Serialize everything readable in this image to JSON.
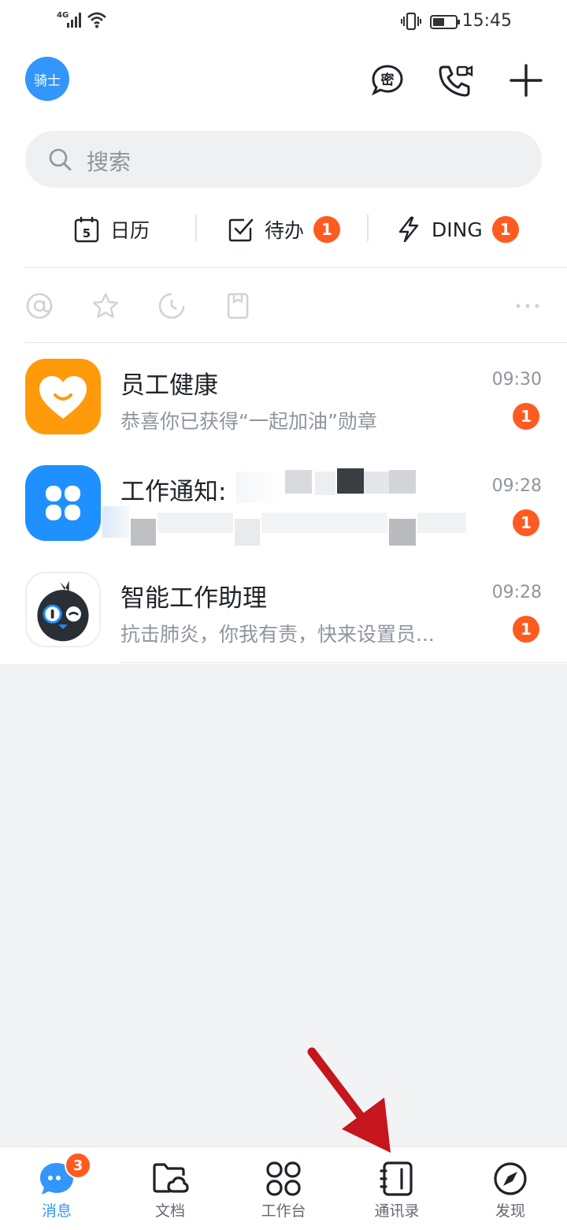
{
  "status_bar": {
    "network": "4G",
    "time": "15:45"
  },
  "header": {
    "avatar_text": "骑士",
    "icons": [
      "secret-chat-icon",
      "video-call-icon",
      "plus-icon"
    ]
  },
  "search": {
    "placeholder": "搜索"
  },
  "quick_bar": {
    "calendar": {
      "label": "日历",
      "day": "5"
    },
    "todo": {
      "label": "待办",
      "badge": "1"
    },
    "ding": {
      "label": "DING",
      "badge": "1"
    }
  },
  "filters": [
    "at-icon",
    "star-icon",
    "clock-icon",
    "bookmark-icon",
    "more-icon"
  ],
  "conversations": [
    {
      "title": "员工健康",
      "preview": "恭喜你已获得“一起加油”勋章",
      "time": "09:30",
      "badge": "1",
      "icon": "heart-app-icon",
      "color": "#ff9a0a"
    },
    {
      "title": "工作通知:",
      "preview": "",
      "time": "09:28",
      "badge": "1",
      "icon": "clover-app-icon",
      "color": "#1e90ff"
    },
    {
      "title": "智能工作助理",
      "preview": "抗击肺炎，你我有责，快来设置员...",
      "time": "09:28",
      "badge": "1",
      "icon": "robot-bird-icon",
      "color": "#ffffff"
    }
  ],
  "bottom_nav": {
    "items": [
      {
        "label": "消息",
        "badge": "3",
        "active": true
      },
      {
        "label": "文档"
      },
      {
        "label": "工作台"
      },
      {
        "label": "通讯录"
      },
      {
        "label": "发现"
      }
    ]
  },
  "colors": {
    "accent": "#3296fa",
    "badge": "#ff5a1f",
    "annotation_arrow": "#c4161c"
  }
}
